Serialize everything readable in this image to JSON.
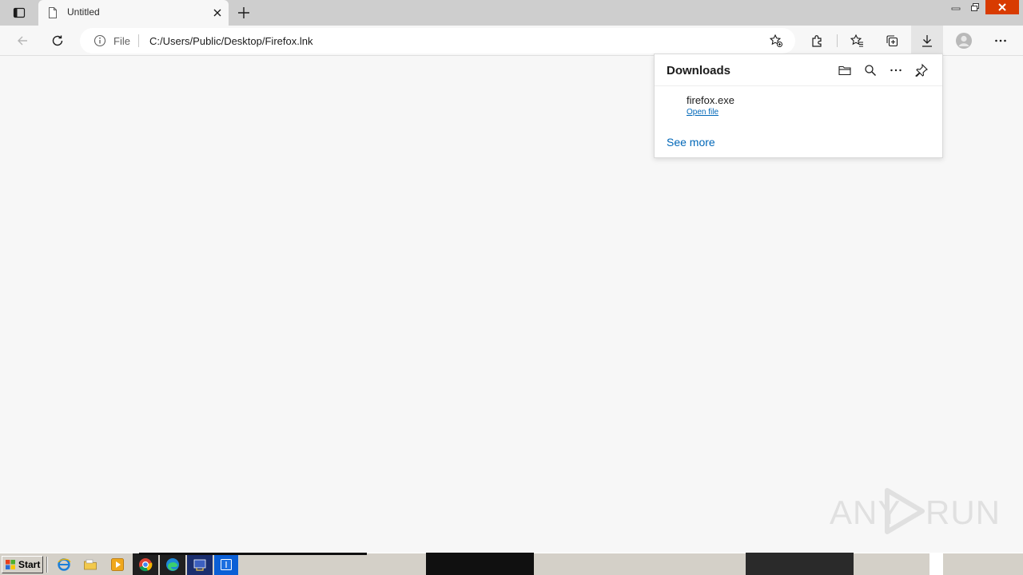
{
  "tab": {
    "title": "Untitled"
  },
  "address": {
    "scheme_label": "File",
    "url": "C:/Users/Public/Desktop/Firefox.lnk"
  },
  "downloads": {
    "title": "Downloads",
    "items": [
      {
        "name": "firefox.exe",
        "action": "Open file"
      }
    ],
    "see_more": "See more"
  },
  "taskbar": {
    "start_label": "Start"
  },
  "watermark": {
    "left": "ANY",
    "right": "RUN"
  },
  "colors": {
    "accent_link": "#0067b8",
    "close_button": "#d83b01"
  }
}
